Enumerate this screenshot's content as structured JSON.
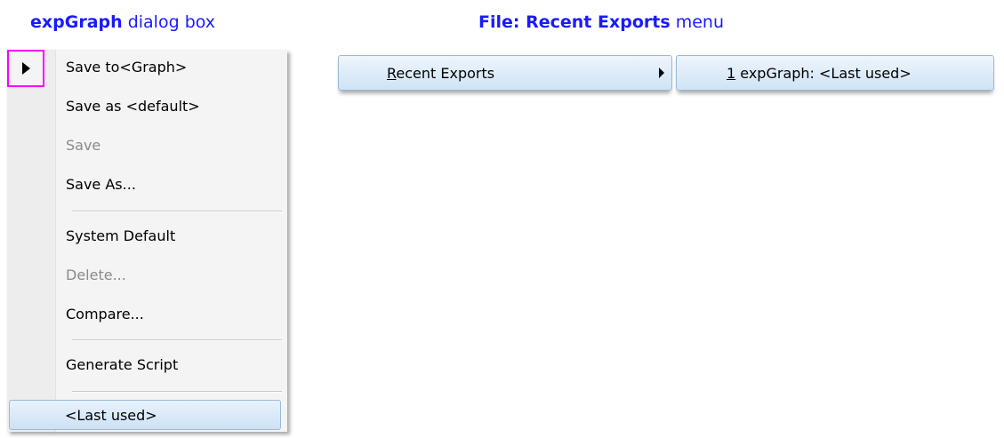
{
  "headings": {
    "left": {
      "bold": "expGraph",
      "rest": "dialog box"
    },
    "right": {
      "bold": "File: Recent Exports",
      "rest": "menu"
    }
  },
  "left_menu": {
    "items": [
      {
        "label": "Save to<Graph>",
        "enabled": true
      },
      {
        "label": "Save as <default>",
        "enabled": true
      },
      {
        "label": "Save",
        "enabled": false
      },
      {
        "label": "Save As...",
        "enabled": true
      },
      {
        "label": "System Default",
        "enabled": true
      },
      {
        "label": "Delete...",
        "enabled": false
      },
      {
        "label": "Compare...",
        "enabled": true
      },
      {
        "label": "Generate Script",
        "enabled": true
      }
    ],
    "last_used": "<Last used>"
  },
  "right_menu": {
    "recent_exports": {
      "mnemonic": "R",
      "rest": "ecent Exports"
    },
    "export_item": {
      "mnemonic": "1",
      "rest": " expGraph: <Last used>"
    }
  },
  "colors": {
    "heading": "#1a1aff",
    "highlight_border": "#ff00ff",
    "menu_hover_border": "#9cb8d6"
  }
}
